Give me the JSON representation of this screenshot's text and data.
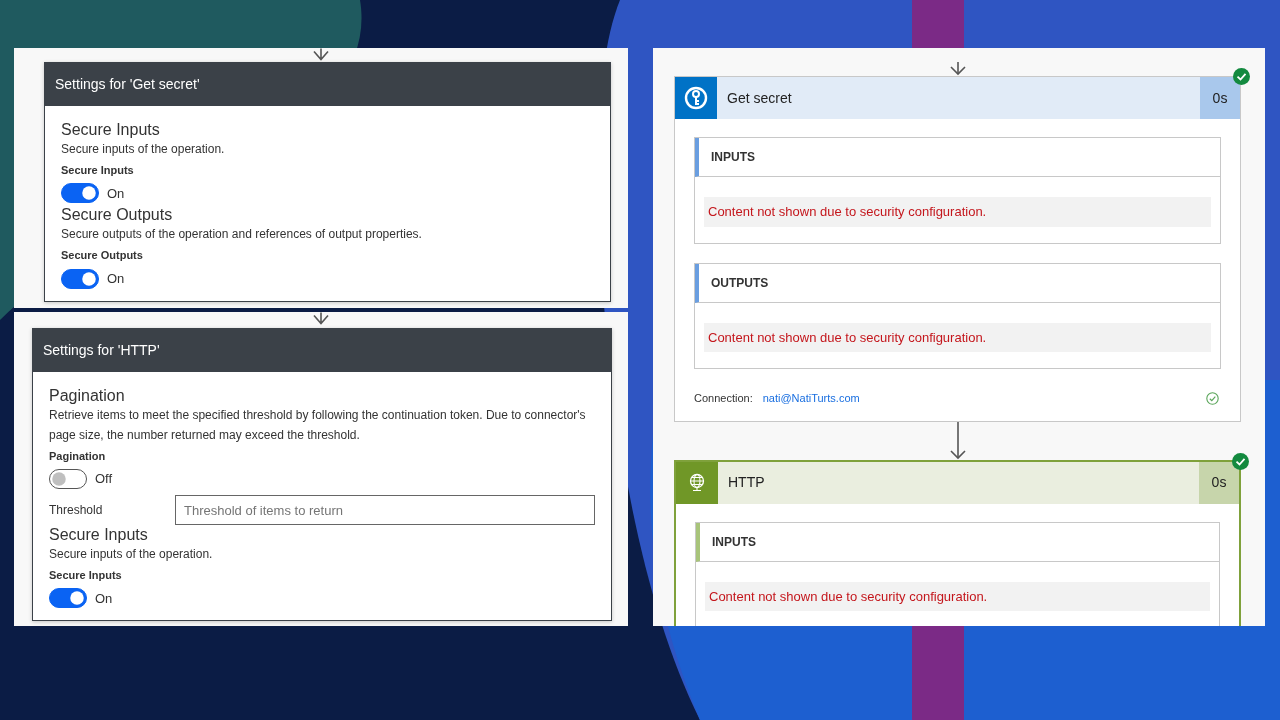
{
  "settings_panels": [
    {
      "title": "Settings for 'Get secret'",
      "sections": [
        {
          "kind": "toggle",
          "heading": "Secure Inputs",
          "description": "Secure inputs of the operation.",
          "label": "Secure Inputs",
          "on": true,
          "state_text": "On"
        },
        {
          "kind": "toggle",
          "heading": "Secure Outputs",
          "description": "Secure outputs of the operation and references of output properties.",
          "label": "Secure Outputs",
          "on": true,
          "state_text": "On"
        }
      ]
    },
    {
      "title": "Settings for 'HTTP'",
      "sections": [
        {
          "kind": "toggle",
          "heading": "Pagination",
          "description": "Retrieve items to meet the specified threshold by following the continuation token. Due to connector's page size, the number returned may exceed the threshold.",
          "label": "Pagination",
          "on": false,
          "state_text": "Off"
        },
        {
          "kind": "field",
          "label": "Threshold",
          "placeholder": "Threshold of items to return"
        },
        {
          "kind": "toggle",
          "heading": "Secure Inputs",
          "description": "Secure inputs of the operation.",
          "label": "Secure Inputs",
          "on": true,
          "state_text": "On"
        }
      ]
    }
  ],
  "run_actions": [
    {
      "name": "Get secret",
      "kind": "key_vault",
      "duration": "0s",
      "succeeded": true,
      "sections": [
        {
          "heading": "INPUTS",
          "message": "Content not shown due to security configuration."
        },
        {
          "heading": "OUTPUTS",
          "message": "Content not shown due to security configuration."
        }
      ],
      "connection": {
        "label": "Connection:",
        "account": "nati@NatiTurts.com",
        "verified": true
      }
    },
    {
      "name": "HTTP",
      "kind": "http",
      "duration": "0s",
      "succeeded": true,
      "sections": [
        {
          "heading": "INPUTS",
          "message": "Content not shown due to security configuration."
        }
      ]
    }
  ]
}
